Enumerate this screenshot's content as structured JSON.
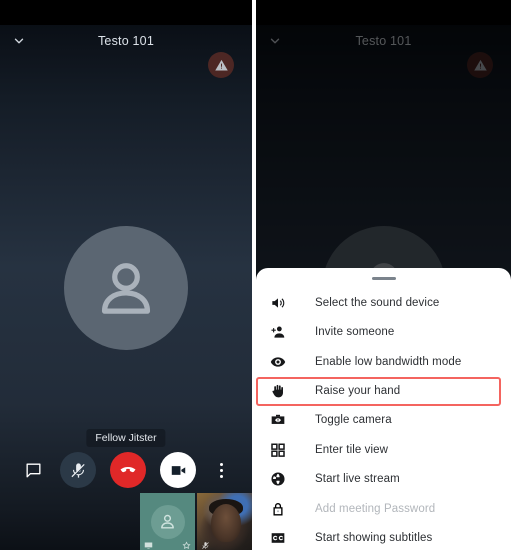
{
  "left_screen": {
    "header": {
      "collapse_icon": "chevron-down-icon",
      "title": "Testo 101",
      "warning_icon": "warning-triangle-icon"
    },
    "stage": {
      "avatar_icon": "person-avatar-icon",
      "participant_name": "Fellow Jitster"
    },
    "toolbar": {
      "buttons": [
        {
          "name": "chat-button",
          "icon": "chat-bubble-icon",
          "label": "Chat"
        },
        {
          "name": "mic-button",
          "icon": "microphone-muted-icon",
          "label": "Unmute"
        },
        {
          "name": "hangup-button",
          "icon": "phone-hangup-icon",
          "label": "Leave"
        },
        {
          "name": "camera-button",
          "icon": "video-camera-icon",
          "label": "Stop camera"
        },
        {
          "name": "more-button",
          "icon": "more-vertical-icon",
          "label": "More actions"
        }
      ]
    },
    "filmstrip": [
      {
        "name": "self-thumbnail",
        "badge_left": "screen-share-icon",
        "badge_right": "star-icon"
      },
      {
        "name": "peer-thumbnail",
        "badge_left": "microphone-muted-icon"
      }
    ]
  },
  "right_screen": {
    "header": {
      "collapse_icon": "chevron-down-icon",
      "title": "Testo 101",
      "warning_icon": "warning-triangle-icon"
    },
    "sheet": {
      "handle": "drag-handle",
      "highlight_color": "#f4645f",
      "items": [
        {
          "icon": "speaker-icon",
          "label": "Select the sound device",
          "disabled": false,
          "highlighted": false
        },
        {
          "icon": "add-person-icon",
          "label": "Invite someone",
          "disabled": false,
          "highlighted": false
        },
        {
          "icon": "eye-icon",
          "label": "Enable low bandwidth mode",
          "disabled": false,
          "highlighted": false
        },
        {
          "icon": "raised-hand-icon",
          "label": "Raise your hand",
          "disabled": false,
          "highlighted": true
        },
        {
          "icon": "camera-toggle-icon",
          "label": "Toggle camera",
          "disabled": false,
          "highlighted": false
        },
        {
          "icon": "grid-tile-icon",
          "label": "Enter tile view",
          "disabled": false,
          "highlighted": false
        },
        {
          "icon": "globe-icon",
          "label": "Start live stream",
          "disabled": false,
          "highlighted": false
        },
        {
          "icon": "lock-icon",
          "label": "Add meeting Password",
          "disabled": true,
          "highlighted": false
        },
        {
          "icon": "closed-caption-icon",
          "label": "Start showing subtitles",
          "disabled": false,
          "highlighted": false
        }
      ]
    }
  }
}
